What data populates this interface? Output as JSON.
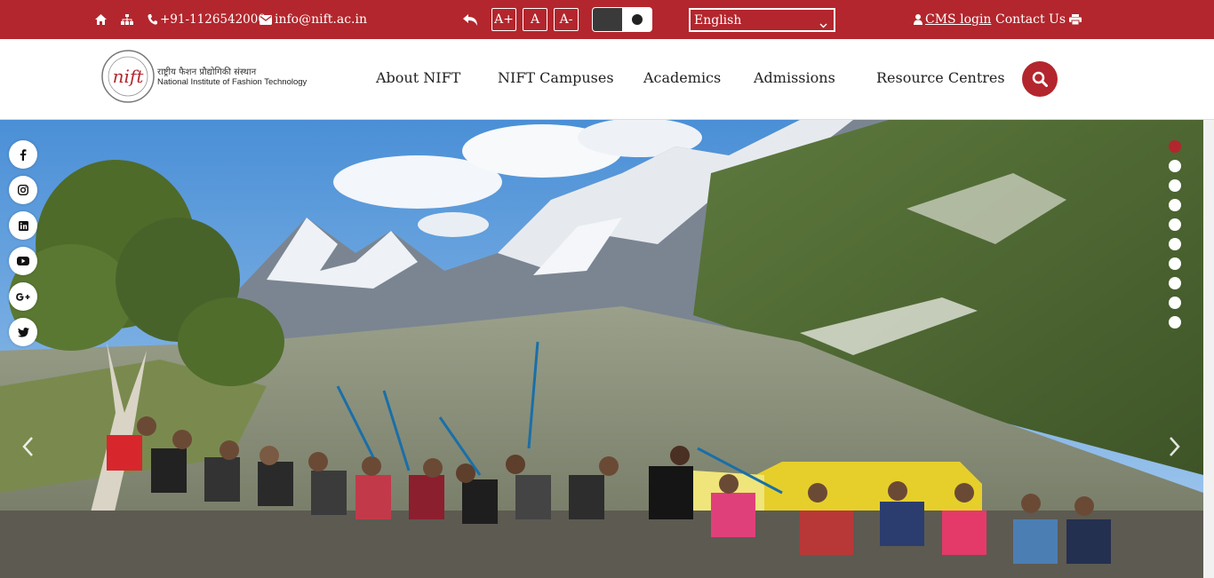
{
  "topbar": {
    "phone": "+91-1126542000",
    "email": "info@nift.ac.in",
    "font_increase": "A+",
    "font_normal": "A",
    "font_decrease": "A-",
    "language_selected": "English",
    "cms_login": "CMS login",
    "contact_us": "Contact Us",
    "icons": [
      "home-icon",
      "sitemap-icon",
      "phone-icon",
      "envelope-icon",
      "back-icon",
      "user-icon",
      "print-icon"
    ]
  },
  "header": {
    "logo_hindi": "राष्ट्रीय फैशन प्रौद्योगिकी संस्थान",
    "logo_english": "National Institute of Fashion Technology",
    "logo_mark": "nift",
    "nav": [
      "About NIFT",
      "NIFT Campuses",
      "Academics",
      "Admissions",
      "Resource Centres"
    ],
    "search_icon": "search-icon"
  },
  "social": [
    "facebook-icon",
    "instagram-icon",
    "linkedin-icon",
    "youtube-icon",
    "google-plus-icon",
    "twitter-icon"
  ],
  "carousel": {
    "slide_count": 10,
    "active_slide": 1,
    "prev_icon": "chevron-left-icon",
    "next_icon": "chevron-right-icon"
  },
  "colors": {
    "brand_red": "#b3262d",
    "white": "#ffffff"
  }
}
